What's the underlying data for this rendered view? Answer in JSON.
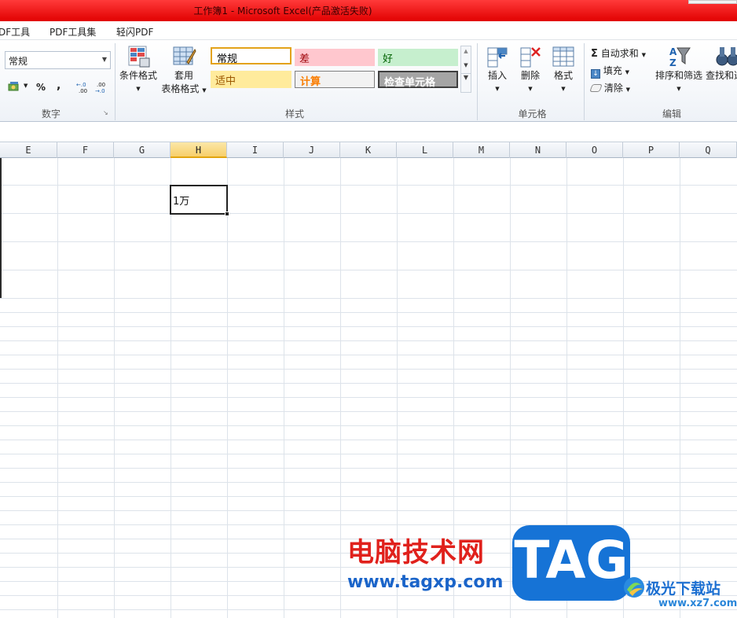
{
  "window": {
    "title": "工作簿1  -  Microsoft Excel(产品激活失败)"
  },
  "menu": {
    "items": [
      "DF工具",
      "PDF工具集",
      "轻闪PDF"
    ]
  },
  "ribbon": {
    "number_group": {
      "format_value": "常规",
      "percent": "%",
      "comma": ",",
      "label": "数字"
    },
    "styles_group": {
      "conditional_format": "条件格式",
      "table_format_line1": "套用",
      "table_format_line2": "表格格式",
      "cells": [
        {
          "label": "常规",
          "bg": "#ffffff",
          "fg": "#000000",
          "border": "#e3a21a"
        },
        {
          "label": "差",
          "bg": "#ffc7ce",
          "fg": "#9c0006",
          "border": "#ffc7ce"
        },
        {
          "label": "好",
          "bg": "#c6efce",
          "fg": "#006100",
          "border": "#c6efce"
        },
        {
          "label": "适中",
          "bg": "#ffeb9c",
          "fg": "#9c5700",
          "border": "#ffeb9c"
        },
        {
          "label": "计算",
          "bg": "#f2f2f2",
          "fg": "#fa7d00",
          "border": "#7f7f7f"
        },
        {
          "label": "检查单元格",
          "bg": "#a5a5a5",
          "fg": "#ffffff",
          "border": "#3f3f3f"
        }
      ],
      "label": "样式"
    },
    "cells_group": {
      "insert": "插入",
      "delete": "删除",
      "format": "格式",
      "label": "单元格"
    },
    "editing_group": {
      "autosum": "自动求和",
      "fill": "填充",
      "clear": "清除",
      "sort_filter": "排序和筛选",
      "find_select": "查找和选",
      "label": "编辑"
    }
  },
  "sheet": {
    "columns": [
      "E",
      "F",
      "G",
      "H",
      "I",
      "J",
      "K",
      "L",
      "M",
      "N",
      "O",
      "P",
      "Q"
    ],
    "selected_column": "H",
    "active_cell": {
      "column": "H",
      "value": "1万"
    }
  },
  "watermark": {
    "cn_text": "电脑技术网",
    "url": "www.tagxp.com",
    "tag": "TAG",
    "site2_name": "极光下载站",
    "site2_url": "www.xz7.com"
  },
  "colors": {
    "title_bar": "#e10000",
    "selected_header": "#f7cf6a",
    "grid_line": "#dde3ea"
  }
}
